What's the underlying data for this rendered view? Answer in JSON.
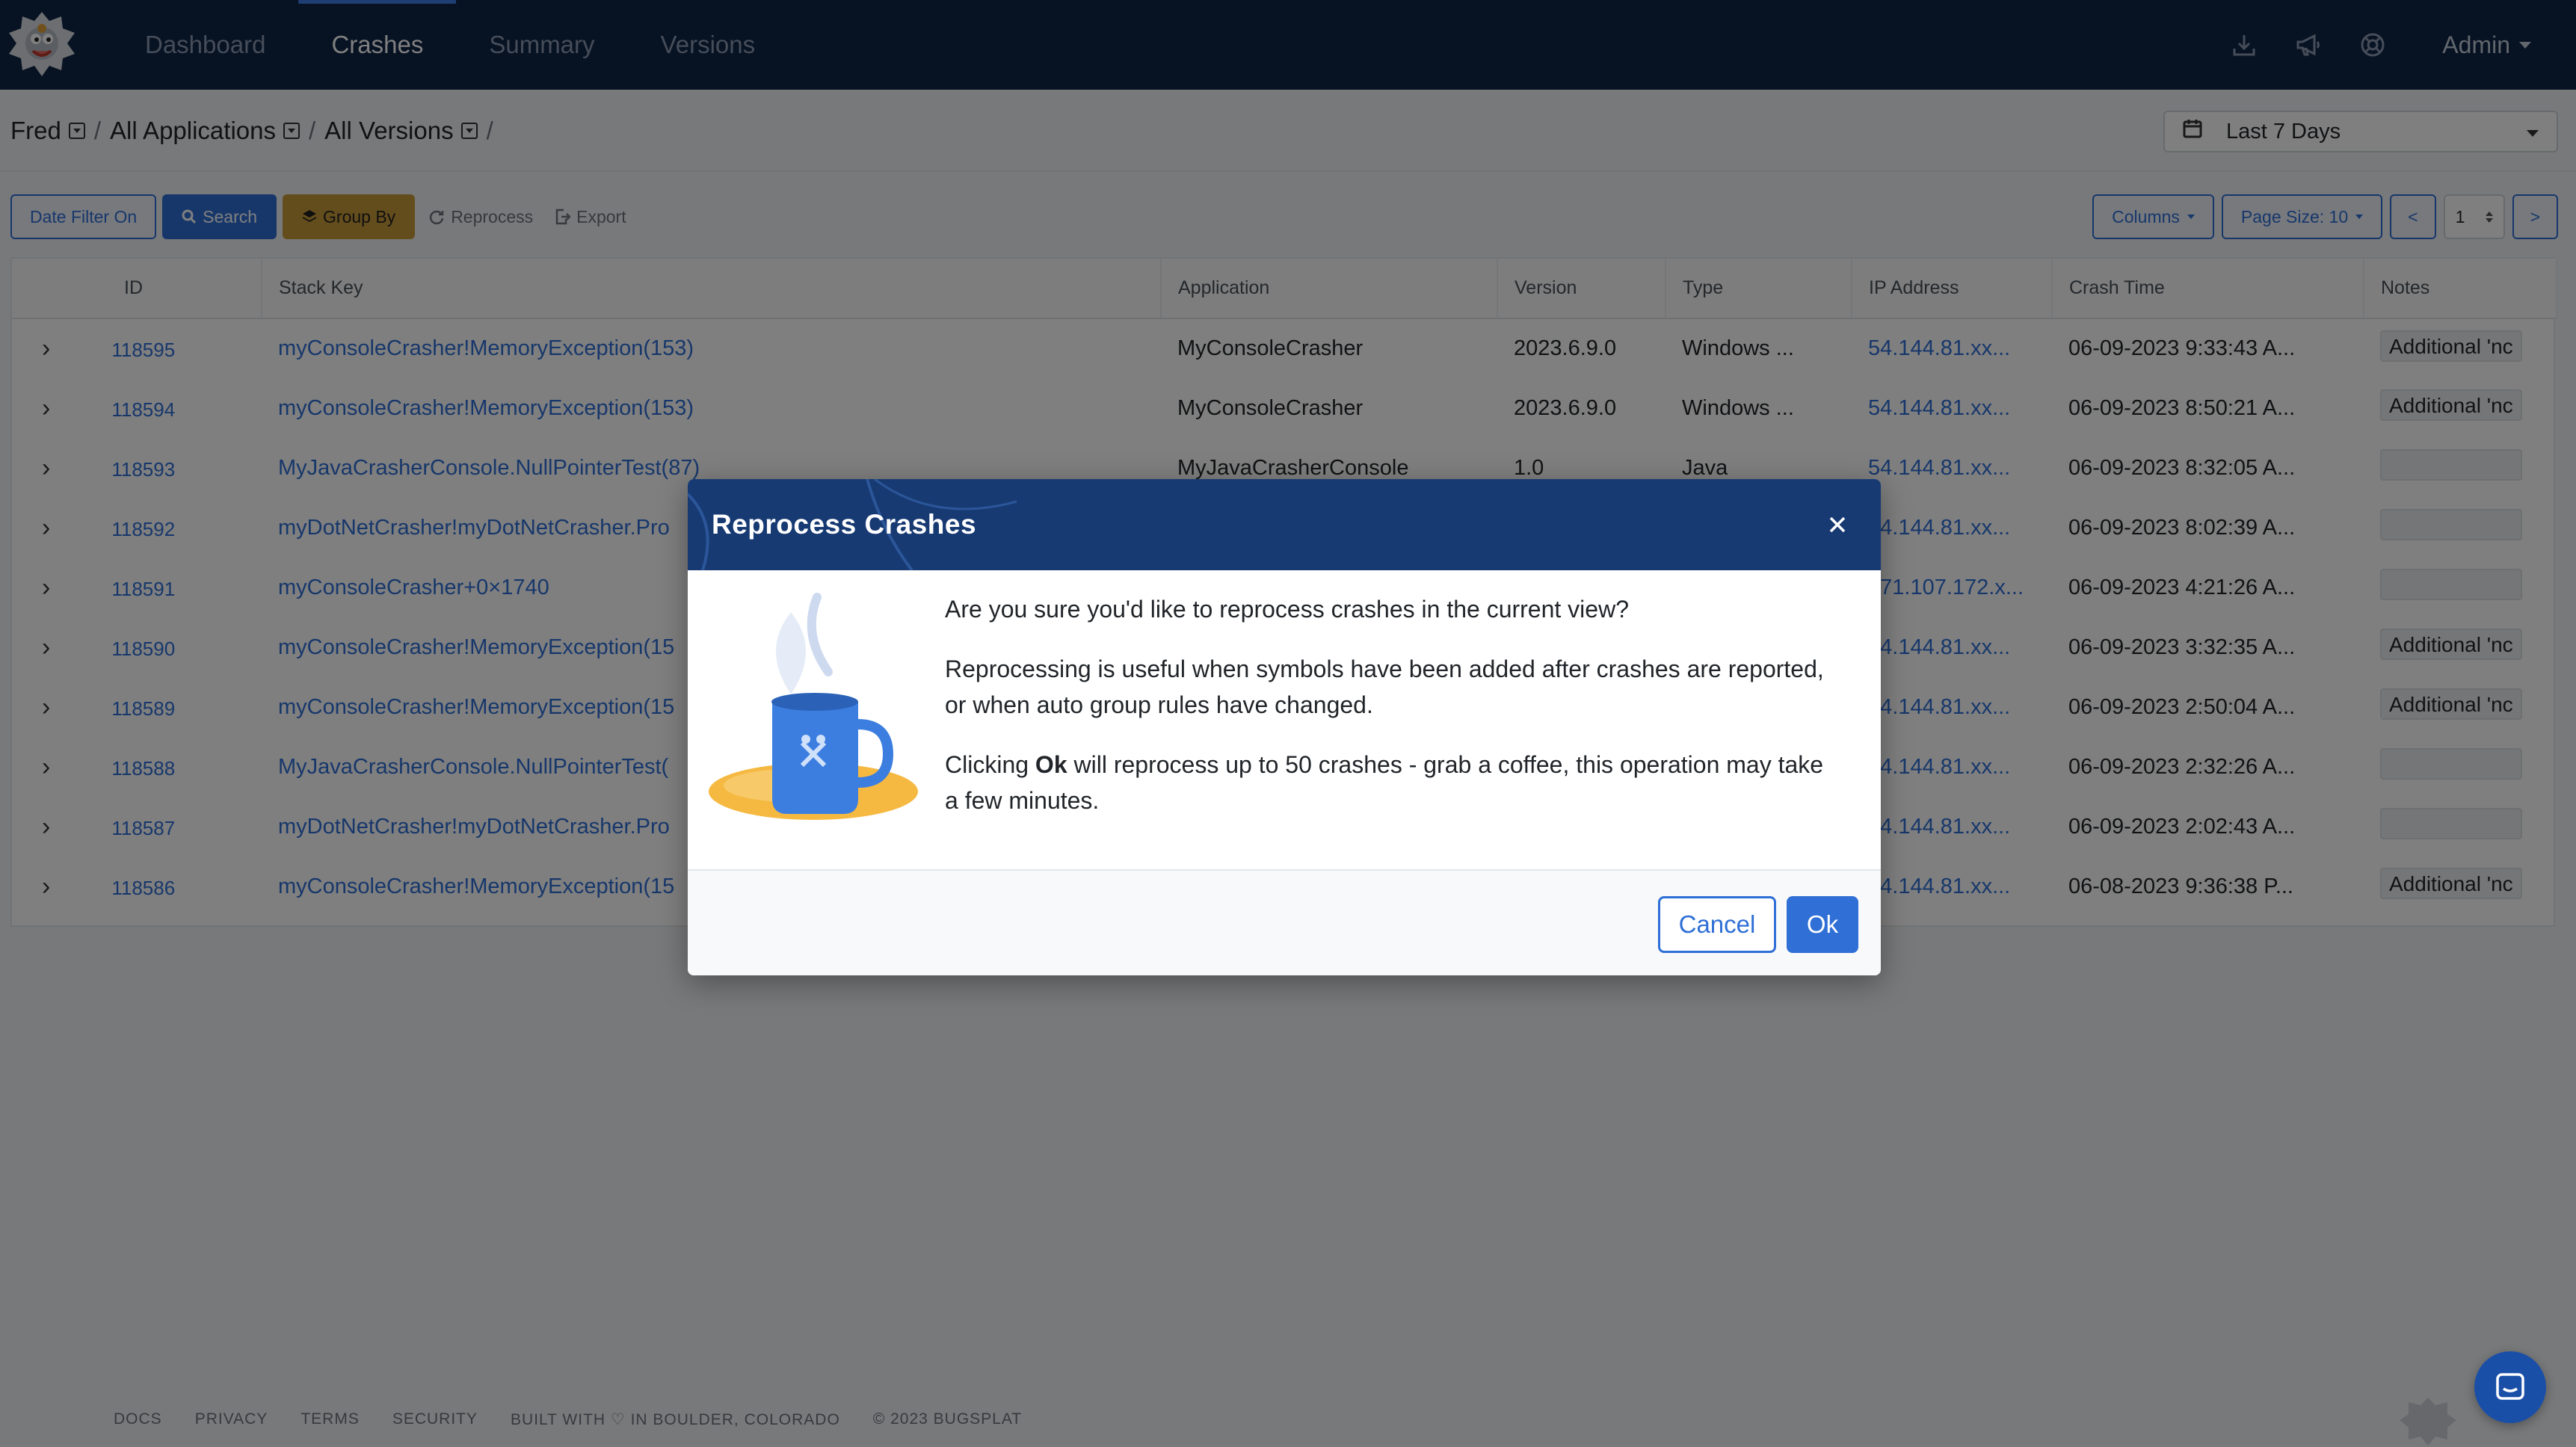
{
  "nav": {
    "links": [
      {
        "label": "Dashboard",
        "active": false
      },
      {
        "label": "Crashes",
        "active": true
      },
      {
        "label": "Summary",
        "active": false
      },
      {
        "label": "Versions",
        "active": false
      }
    ],
    "icons": [
      "download-icon",
      "megaphone-icon",
      "support-icon"
    ],
    "user_label": "Admin"
  },
  "breadcrumb": {
    "items": [
      "Fred",
      "All Applications",
      "All Versions"
    ],
    "separator": "/"
  },
  "date_range": {
    "selected": "Last 7 Days"
  },
  "toolbar": {
    "date_filter": "Date Filter On",
    "search": "Search",
    "group_by": "Group By",
    "reprocess": "Reprocess",
    "export": "Export",
    "columns": "Columns",
    "page_size": "Page Size: 10",
    "prev": "<",
    "page": "1",
    "next": ">"
  },
  "table": {
    "headers": [
      "ID",
      "Stack Key",
      "Application",
      "Version",
      "Type",
      "IP Address",
      "Crash Time",
      "Notes"
    ],
    "rows": [
      {
        "id": "118595",
        "stack": "myConsoleCrasher!MemoryException(153)",
        "app": "MyConsoleCrasher",
        "version": "2023.6.9.0",
        "type": "Windows ...",
        "ip": "54.144.81.xx...",
        "time": "06-09-2023 9:33:43 A...",
        "notes": "Additional 'nc"
      },
      {
        "id": "118594",
        "stack": "myConsoleCrasher!MemoryException(153)",
        "app": "MyConsoleCrasher",
        "version": "2023.6.9.0",
        "type": "Windows ...",
        "ip": "54.144.81.xx...",
        "time": "06-09-2023 8:50:21 A...",
        "notes": "Additional 'nc"
      },
      {
        "id": "118593",
        "stack": "MyJavaCrasherConsole.NullPointerTest(87)",
        "app": "MyJavaCrasherConsole",
        "version": "1.0",
        "type": "Java",
        "ip": "54.144.81.xx...",
        "time": "06-09-2023 8:32:05 A...",
        "notes": ""
      },
      {
        "id": "118592",
        "stack": "myDotNetCrasher!myDotNetCrasher.Pro",
        "app": "",
        "version": "",
        "type": "",
        "ip": "54.144.81.xx...",
        "time": "06-09-2023 8:02:39 A...",
        "notes": ""
      },
      {
        "id": "118591",
        "stack": "myConsoleCrasher+0×1740",
        "app": "",
        "version": "",
        "type": "",
        "ip": "171.107.172.x...",
        "time": "06-09-2023 4:21:26 A...",
        "notes": ""
      },
      {
        "id": "118590",
        "stack": "myConsoleCrasher!MemoryException(15",
        "app": "",
        "version": "",
        "type": "",
        "ip": "54.144.81.xx...",
        "time": "06-09-2023 3:32:35 A...",
        "notes": "Additional 'nc"
      },
      {
        "id": "118589",
        "stack": "myConsoleCrasher!MemoryException(15",
        "app": "",
        "version": "",
        "type": "",
        "ip": "54.144.81.xx...",
        "time": "06-09-2023 2:50:04 A...",
        "notes": "Additional 'nc"
      },
      {
        "id": "118588",
        "stack": "MyJavaCrasherConsole.NullPointerTest(",
        "app": "",
        "version": "",
        "type": "",
        "ip": "54.144.81.xx...",
        "time": "06-09-2023 2:32:26 A...",
        "notes": ""
      },
      {
        "id": "118587",
        "stack": "myDotNetCrasher!myDotNetCrasher.Pro",
        "app": "",
        "version": "",
        "type": "",
        "ip": "54.144.81.xx...",
        "time": "06-09-2023 2:02:43 A...",
        "notes": ""
      },
      {
        "id": "118586",
        "stack": "myConsoleCrasher!MemoryException(15",
        "app": "",
        "version": "",
        "type": "",
        "ip": "54.144.81.xx...",
        "time": "06-08-2023 9:36:38 P...",
        "notes": "Additional 'nc"
      }
    ]
  },
  "footer": {
    "links": [
      "DOCS",
      "PRIVACY",
      "TERMS",
      "SECURITY",
      "BUILT WITH ♡ IN BOULDER, COLORADO",
      "© 2023 BUGSPLAT"
    ]
  },
  "modal": {
    "title": "Reprocess Crashes",
    "line1": "Are you sure you'd like to reprocess crashes in the current view?",
    "line2": "Reprocessing is useful when symbols have been added after crashes are reported, or when auto group rules have changed.",
    "line3_prefix": "Clicking ",
    "line3_bold": "Ok",
    "line3_suffix": " will reprocess up to 50 crashes - grab a coffee, this operation may take a few minutes.",
    "cancel": "Cancel",
    "ok": "Ok"
  },
  "colors": {
    "navbar": "#0f2546",
    "primary": "#2f6fd6",
    "modal_header": "#173a73",
    "warning": "#c99a3a"
  }
}
